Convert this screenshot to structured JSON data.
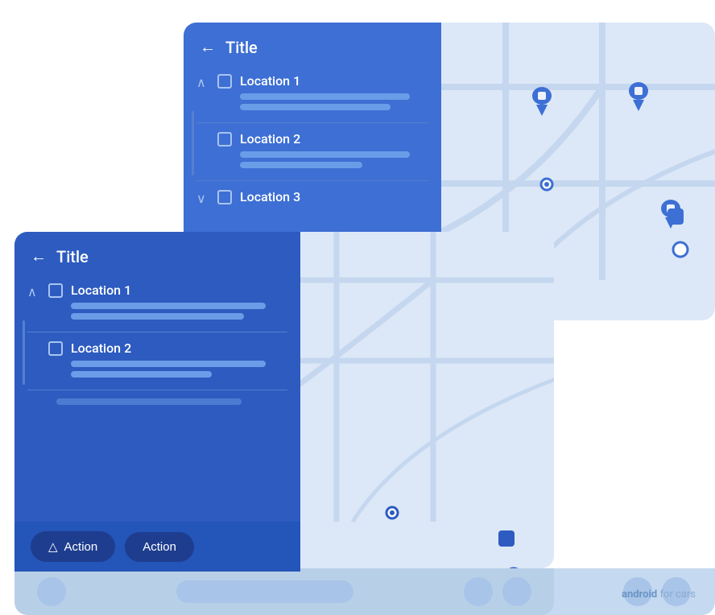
{
  "brand": {
    "text_bold": "android",
    "text_normal": " for cars"
  },
  "back_card": {
    "panel": {
      "back_arrow": "←",
      "title": "Title",
      "items": [
        {
          "label": "Location 1",
          "bars": [
            "long",
            "medium"
          ]
        },
        {
          "label": "Location 2",
          "bars": [
            "long",
            "short"
          ]
        },
        {
          "label": "Location 3",
          "bars": []
        }
      ]
    }
  },
  "front_card": {
    "panel": {
      "back_arrow": "←",
      "title": "Title",
      "items": [
        {
          "label": "Location 1",
          "bars": [
            "long",
            "medium"
          ]
        },
        {
          "label": "Location 2",
          "bars": [
            "long",
            "short"
          ]
        }
      ]
    },
    "action_buttons": [
      {
        "label": "Action",
        "has_icon": true
      },
      {
        "label": "Action",
        "has_icon": false
      }
    ]
  },
  "location_overlay": "Location"
}
